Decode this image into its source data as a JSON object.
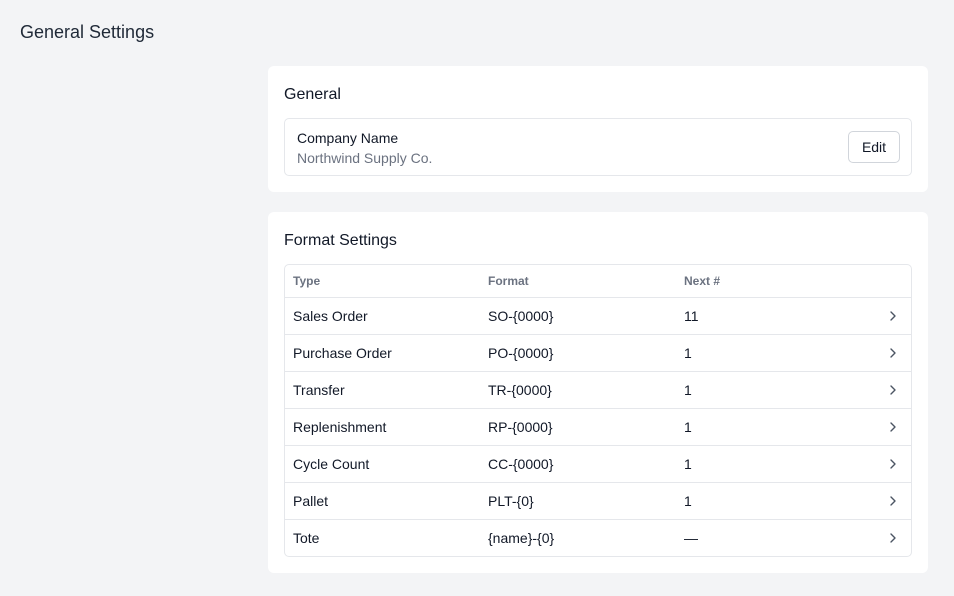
{
  "page": {
    "title": "General Settings"
  },
  "general": {
    "title": "General",
    "company_label": "Company Name",
    "company_value": "Northwind Supply Co.",
    "edit_label": "Edit"
  },
  "format": {
    "title": "Format Settings",
    "columns": [
      "Type",
      "Format",
      "Next #"
    ],
    "rows": [
      {
        "type": "Sales Order",
        "format": "SO-{0000}",
        "next": "11"
      },
      {
        "type": "Purchase Order",
        "format": "PO-{0000}",
        "next": "1"
      },
      {
        "type": "Transfer",
        "format": "TR-{0000}",
        "next": "1"
      },
      {
        "type": "Replenishment",
        "format": "RP-{0000}",
        "next": "1"
      },
      {
        "type": "Cycle Count",
        "format": "CC-{0000}",
        "next": "1"
      },
      {
        "type": "Pallet",
        "format": "PLT-{0}",
        "next": "1"
      },
      {
        "type": "Tote",
        "format": "{name}-{0}",
        "next": "—"
      }
    ],
    "row_icon": "chevron-right-icon"
  }
}
